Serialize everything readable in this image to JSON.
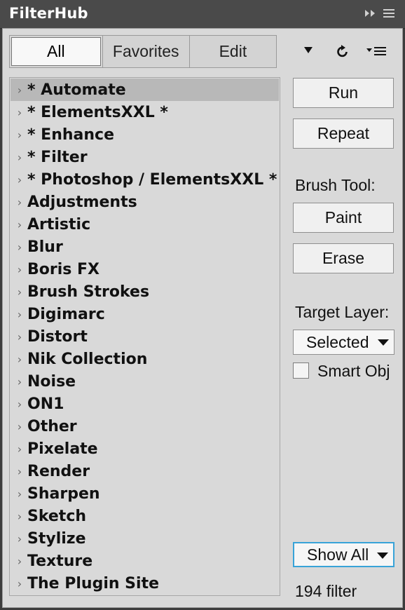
{
  "window": {
    "title": "FilterHub"
  },
  "tabs": [
    "All",
    "Favorites",
    "Edit"
  ],
  "toolbar_icons": [
    "dropdown-icon",
    "refresh-icon",
    "list-menu-icon"
  ],
  "tree": {
    "selected_index": 0,
    "items": [
      "* Automate",
      "* ElementsXXL *",
      "* Enhance",
      "* Filter",
      "* Photoshop / ElementsXXL *",
      "Adjustments",
      "Artistic",
      "Blur",
      "Boris FX",
      "Brush Strokes",
      "Digimarc",
      "Distort",
      "Nik Collection",
      "Noise",
      "ON1",
      "Other",
      "Pixelate",
      "Render",
      "Sharpen",
      "Sketch",
      "Stylize",
      "Texture",
      "The Plugin Site"
    ]
  },
  "actions": {
    "run": "Run",
    "repeat": "Repeat",
    "brush_tool_label": "Brush Tool:",
    "paint": "Paint",
    "erase": "Erase",
    "target_layer_label": "Target Layer:",
    "target_layer_value": "Selected",
    "smart_obj_label": "Smart Obj",
    "smart_obj_checked": false,
    "show_filter_value": "Show All",
    "filter_count": "194 filter"
  },
  "colors": {
    "titlebar": "#4a4a4a",
    "panel": "#d9d9d9",
    "selected_row": "#b8b8b8",
    "focus_border": "#38a3d8"
  }
}
